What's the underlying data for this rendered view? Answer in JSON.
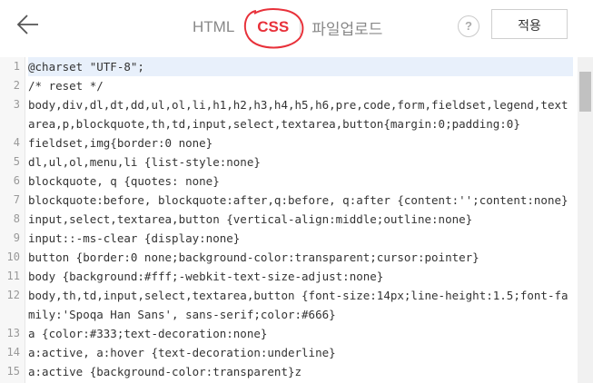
{
  "tabs": {
    "html": "HTML",
    "css": "CSS",
    "upload": "파일업로드"
  },
  "help": "?",
  "apply": "적용",
  "lines": [
    {
      "n": "1",
      "text": "@charset \"UTF-8\";"
    },
    {
      "n": "2",
      "text": "/* reset */"
    },
    {
      "n": "3",
      "text": "body,div,dl,dt,dd,ul,ol,li,h1,h2,h3,h4,h5,h6,pre,code,form,fieldset,legend,textarea,p,blockquote,th,td,input,select,textarea,button{margin:0;padding:0}"
    },
    {
      "n": "4",
      "text": "fieldset,img{border:0 none}"
    },
    {
      "n": "5",
      "text": "dl,ul,ol,menu,li {list-style:none}"
    },
    {
      "n": "6",
      "text": "blockquote, q {quotes: none}"
    },
    {
      "n": "7",
      "text": "blockquote:before, blockquote:after,q:before, q:after {content:'';content:none}"
    },
    {
      "n": "8",
      "text": "input,select,textarea,button {vertical-align:middle;outline:none}"
    },
    {
      "n": "9",
      "text": "input::-ms-clear {display:none}"
    },
    {
      "n": "10",
      "text": "button {border:0 none;background-color:transparent;cursor:pointer}"
    },
    {
      "n": "11",
      "text": "body {background:#fff;-webkit-text-size-adjust:none}"
    },
    {
      "n": "12",
      "text": "body,th,td,input,select,textarea,button {font-size:14px;line-height:1.5;font-family:'Spoqa Han Sans', sans-serif;color:#666}"
    },
    {
      "n": "13",
      "text": "a {color:#333;text-decoration:none}"
    },
    {
      "n": "14",
      "text": "a:active, a:hover {text-decoration:underline}"
    },
    {
      "n": "15",
      "text": "a:active {background-color:transparent}z"
    }
  ]
}
